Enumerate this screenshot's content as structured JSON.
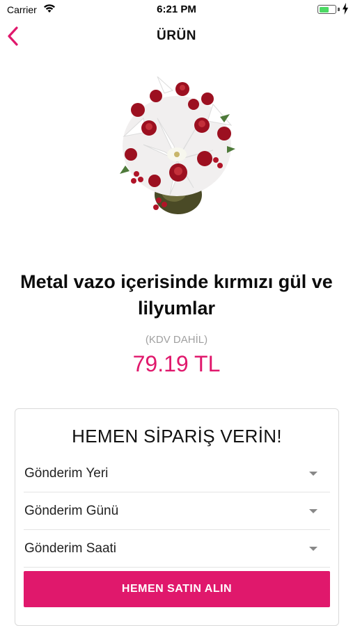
{
  "status_bar": {
    "carrier": "Carrier",
    "time": "6:21 PM",
    "battery_level": 0.6
  },
  "nav": {
    "title": "ÜRÜN",
    "back_icon": "chevron-left-icon"
  },
  "product": {
    "image": "flower-arrangement-image",
    "title": "Metal vazo içerisinde kırmızı gül ve lilyumlar",
    "vat_note": "(KDV DAHİL)",
    "price": "79.19 TL"
  },
  "order": {
    "title": "HEMEN SİPARİŞ VERİN!",
    "fields": [
      {
        "label": "Gönderim Yeri"
      },
      {
        "label": "Gönderim Günü"
      },
      {
        "label": "Gönderim Saati"
      }
    ],
    "buy_label": "HEMEN SATIN ALIN"
  },
  "colors": {
    "accent": "#e0186c",
    "muted_text": "#a0a0a0",
    "battery": "#4cd964"
  }
}
